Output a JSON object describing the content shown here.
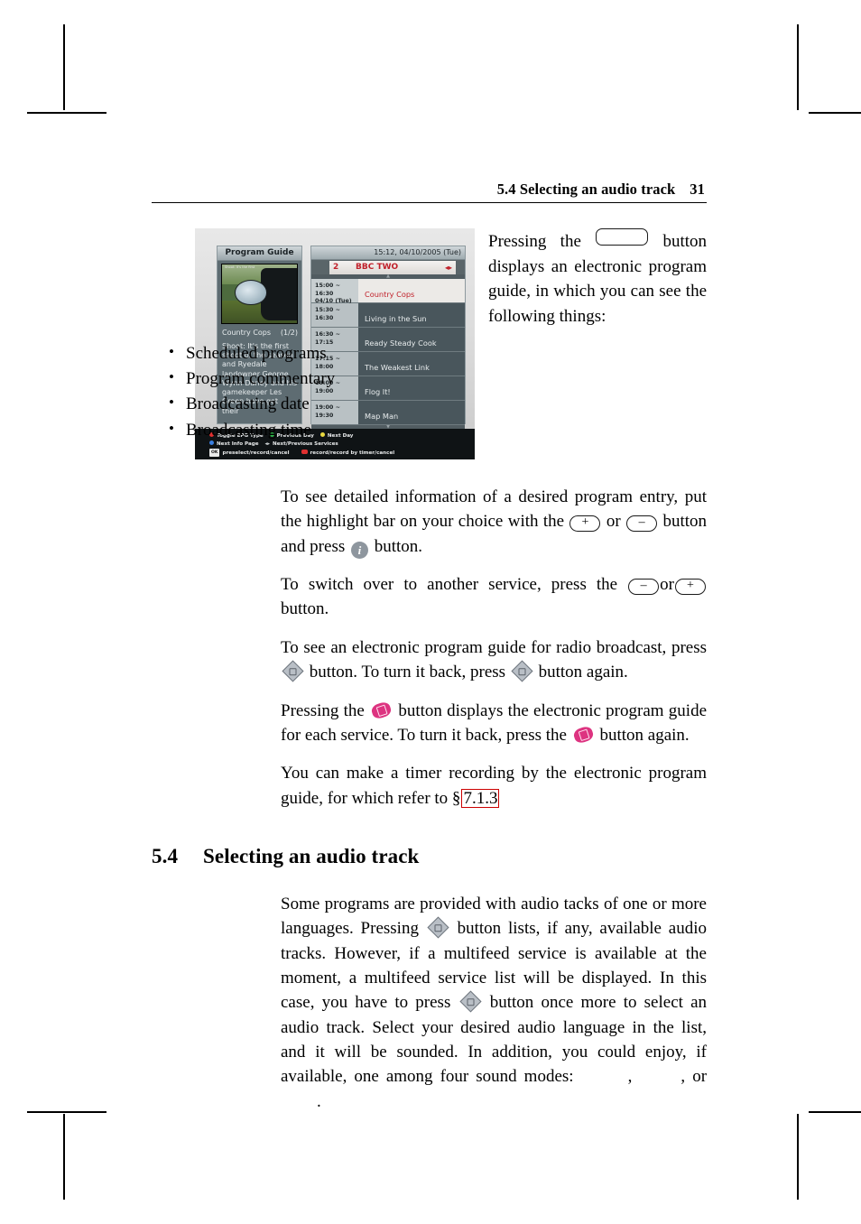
{
  "page": {
    "running_header": "5.4 Selecting an audio track",
    "page_number": "31"
  },
  "figure_paragraph": {
    "before_key": "Pressing the",
    "after_key": "button displays an electronic program guide, in which you can see the following things:"
  },
  "bullets": [
    "Scheduled programs",
    "Program commentary",
    "Broadcasting date",
    "Broadcasting time"
  ],
  "paragraphs": {
    "p1_a": "To see detailed information of a desired program entry, put the highlight bar on your choice with the",
    "p1_plus": "+",
    "p1_or": "or",
    "p1_minus": "–",
    "p1_b": "button and press",
    "p1_c": "button.",
    "p2_a": "To switch over to another service, press the",
    "p2_minus": "–",
    "p2_or": "or",
    "p2_plus": "+",
    "p2_b": "button.",
    "p3_a": "To see an electronic program guide for radio broadcast, press",
    "p3_b": "button. To turn it back, press",
    "p3_c": "button again.",
    "p4_a": "Pressing the",
    "p4_b": "button displays the electronic program guide for each service. To turn it back, press the",
    "p4_c": "button again.",
    "p5_a": "You can make a timer recording by the electronic program guide, for which refer to §",
    "p5_xref": "7.1.3"
  },
  "section": {
    "number": "5.4",
    "title": "Selecting an audio track",
    "body_a": "Some programs are provided with audio tacks of one or more languages.  Pressing",
    "body_b": "button lists, if any, available audio tracks. However, if a multifeed service is available at the moment, a multifeed service list will be displayed.  In this case, you have to press",
    "body_c": "button once more to select an audio track. Select your desired audio language in the list, and it will be sounded. In addition, you could enjoy, if available, one among four sound modes:",
    "mode_sep1": ",",
    "mode_sep2": ",",
    "mode_or": "or",
    "mode_end": "."
  },
  "tv_screenshot": {
    "panel_title": "Program Guide",
    "thumb_caption": "Shoot: It's the first",
    "program_name": "Country Cops",
    "program_page": "(1/2)",
    "description": "Shoot: It's the first shoot of the season and Ryedale landowner George Wynn Darley and his gamekeeper Les Green have got their",
    "clock": "15:12, 04/10/2005 (Tue)",
    "channel_number": "2",
    "channel_name": "BBC TWO",
    "channel_arrows": "◂▸",
    "rows": [
      {
        "time": "15:00 ~ 16:30",
        "date": "04/10 (Tue)",
        "name": "Country Cops",
        "selected": true
      },
      {
        "time": "15:30 ~ 16:30",
        "date": "",
        "name": "Living in the Sun",
        "selected": false
      },
      {
        "time": "16:30 ~ 17:15",
        "date": "",
        "name": "Ready Steady Cook",
        "selected": false
      },
      {
        "time": "17:15 ~ 18:00",
        "date": "",
        "name": "The Weakest Link",
        "selected": false
      },
      {
        "time": "18:00 ~ 19:00",
        "date": "",
        "name": "Flog It!",
        "selected": false
      },
      {
        "time": "19:00 ~ 19:30",
        "date": "",
        "name": "Map Man",
        "selected": false
      }
    ],
    "legend": {
      "red": "Toggle EPG Type",
      "green": "Previous Day",
      "yellow": "Next Day",
      "blue": "Next Info Page",
      "arrows_label": "Next/Previous Services",
      "arrows_glyph": "◂▸",
      "ok_key": "OK",
      "ok_label": "preselect/record/cancel",
      "rec_label": "record/record by timer/cancel"
    }
  },
  "colors": {
    "xref_box": "#cc0000",
    "osd_red_text": "#c0202a",
    "pink_button": "#dd3380",
    "info_button": "#8e969e"
  }
}
